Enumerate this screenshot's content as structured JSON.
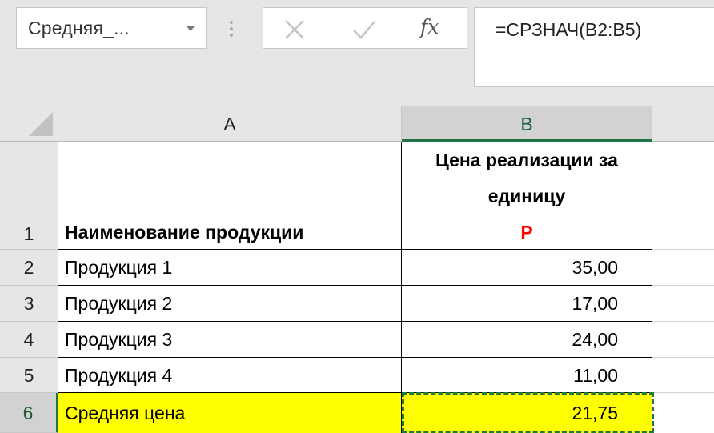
{
  "formula_bar": {
    "name_box": "Средняя_...",
    "fx_label": "fx",
    "formula": "=СРЗНАЧ(B2:B5)"
  },
  "icons": {
    "name_box_dropdown": "chevron-down-icon",
    "cancel": "close-icon",
    "enter": "check-icon",
    "insert_function": "function-icon"
  },
  "sheet": {
    "columns": [
      "A",
      "B"
    ],
    "rows": [
      "1",
      "2",
      "3",
      "4",
      "5",
      "6"
    ],
    "header": {
      "a": "Наименование продукции",
      "b_line1": "Цена реализации за",
      "b_line2": "единицу",
      "b_line3": "Р"
    },
    "data": [
      {
        "name": "Продукция 1",
        "price": "35,00"
      },
      {
        "name": "Продукция 2",
        "price": "17,00"
      },
      {
        "name": "Продукция 3",
        "price": "24,00"
      },
      {
        "name": "Продукция 4",
        "price": "11,00"
      }
    ],
    "total": {
      "name": "Средняя цена",
      "price": "21,75"
    }
  },
  "colors": {
    "accent": "#217346",
    "highlight": "#ffff00",
    "currency": "#ff0000"
  }
}
